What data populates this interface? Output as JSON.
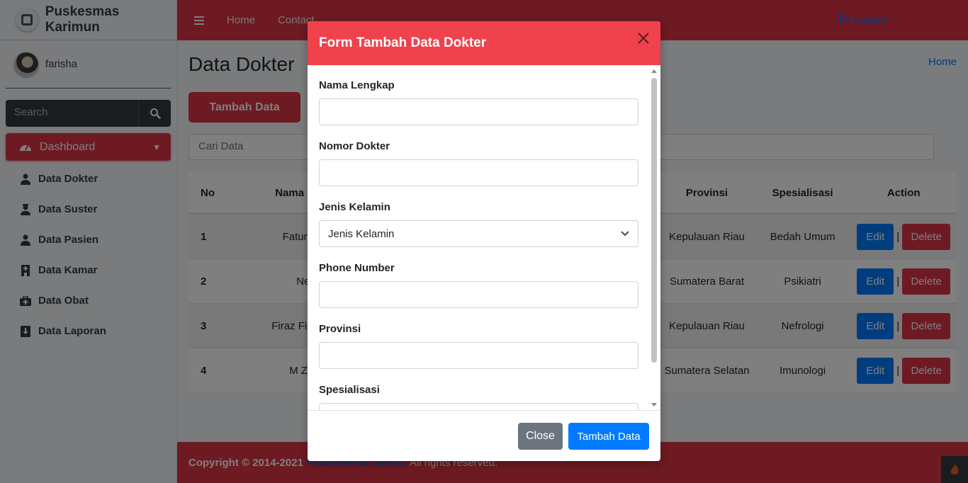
{
  "brand": {
    "title": "Puskesmas Karimun"
  },
  "user": {
    "name": "farisha"
  },
  "sidebar": {
    "search_placeholder": "Search",
    "dashboard_label": "Dashboard",
    "items": [
      {
        "label": "Data Dokter",
        "icon": "user-md-icon"
      },
      {
        "label": "Data Suster",
        "icon": "user-nurse-icon"
      },
      {
        "label": "Data Pasien",
        "icon": "user-injured-icon"
      },
      {
        "label": "Data Kamar",
        "icon": "hospital-icon"
      },
      {
        "label": "Data Obat",
        "icon": "medkit-icon"
      },
      {
        "label": "Data Laporan",
        "icon": "report-icon"
      }
    ]
  },
  "topbar": {
    "home": "Home",
    "contact": "Contact",
    "logout": "Logout"
  },
  "main": {
    "title": "Data Dokter",
    "breadcrumb": "Home",
    "add_button": "Tambah Data",
    "search_placeholder": "Cari Data",
    "table": {
      "headers": {
        "no": "No",
        "nama": "Nama Lengkap",
        "provinsi": "Provinsi",
        "spesialisasi": "Spesialisasi",
        "action": "Action"
      },
      "rows": [
        {
          "no": "1",
          "nama": "Faturrahman",
          "provinsi": "Kepulauan Riau",
          "spesialisasi": "Bedah Umum"
        },
        {
          "no": "2",
          "nama": "Nelson",
          "provinsi": "Sumatera Barat",
          "spesialisasi": "Psikiatri"
        },
        {
          "no": "3",
          "nama": "Firaz Firza Najwa",
          "provinsi": "Kepulauan Riau",
          "spesialisasi": "Nefrologi"
        },
        {
          "no": "4",
          "nama": "M Ziyan A",
          "provinsi": "Sumatera Selatan",
          "spesialisasi": "Imunologi"
        }
      ],
      "edit_label": "Edit",
      "delete_label": "Delete",
      "separator": "|"
    }
  },
  "footer": {
    "copyright": "Copyright © 2014-2021",
    "author": "Faturrahman Adarsi",
    "rights": "All rights reserved."
  },
  "modal": {
    "title": "Form Tambah Data Dokter",
    "fields": {
      "nama": "Nama Lengkap",
      "nomor": "Nomor Dokter",
      "jenis": "Jenis Kelamin",
      "jenis_value": "Jenis Kelamin",
      "phone": "Phone Number",
      "provinsi": "Provinsi",
      "spesialisasi": "Spesialisasi"
    },
    "close_label": "Close",
    "submit_label": "Tambah Data"
  },
  "colors": {
    "primary_red": "#dc3545",
    "modal_header": "#ef424c",
    "blue": "#007bff",
    "gray_button": "#6c757d"
  }
}
